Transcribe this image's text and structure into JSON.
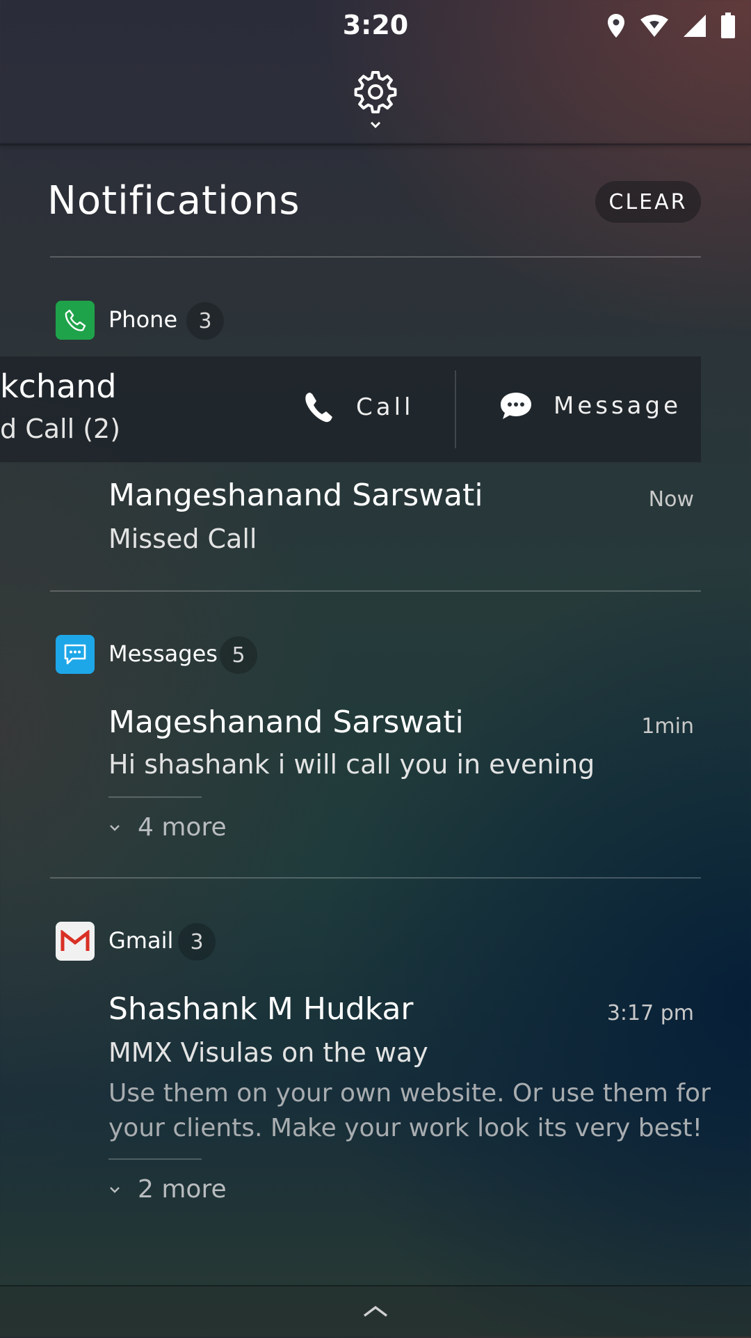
{
  "status_bar": {
    "time": "3:20",
    "icons": [
      "location-icon",
      "wifi-icon",
      "signal-icon",
      "battery-icon"
    ]
  },
  "header": {
    "settings_icon": "gear-icon",
    "expand_icon": "chevron-down-icon"
  },
  "panel": {
    "title": "Notifications",
    "clear_label": "CLEAR"
  },
  "groups": {
    "phone": {
      "app_name": "Phone",
      "count": "3",
      "icon": "phone-icon",
      "color": "#1fa34a",
      "swiped_item": {
        "name_visible": "kchand",
        "subtitle_visible": "d Call (2)",
        "actions": {
          "call_label": "Call",
          "message_label": "Message"
        }
      },
      "item": {
        "name": "Mangeshanand Sarswati",
        "text": "Missed Call",
        "time": "Now"
      }
    },
    "messages": {
      "app_name": "Messages",
      "count": "5",
      "icon": "message-bubble-icon",
      "color": "#1ea7e8",
      "item": {
        "name": "Mageshanand Sarswati",
        "text": "Hi shashank i will call you in evening",
        "time": "1min"
      },
      "more_label": "4 more"
    },
    "gmail": {
      "app_name": "Gmail",
      "count": "3",
      "icon": "gmail-icon",
      "color": "#d93025",
      "item": {
        "name": "Shashank M Hudkar",
        "subject": "MMX Visulas on the way",
        "body": "Use them on your own website. Or use them for your clients. Make your work look its very best!",
        "time": "3:17 pm"
      },
      "more_label": "2 more"
    }
  },
  "bottom_bar": {
    "collapse_icon": "chevron-up-icon"
  }
}
